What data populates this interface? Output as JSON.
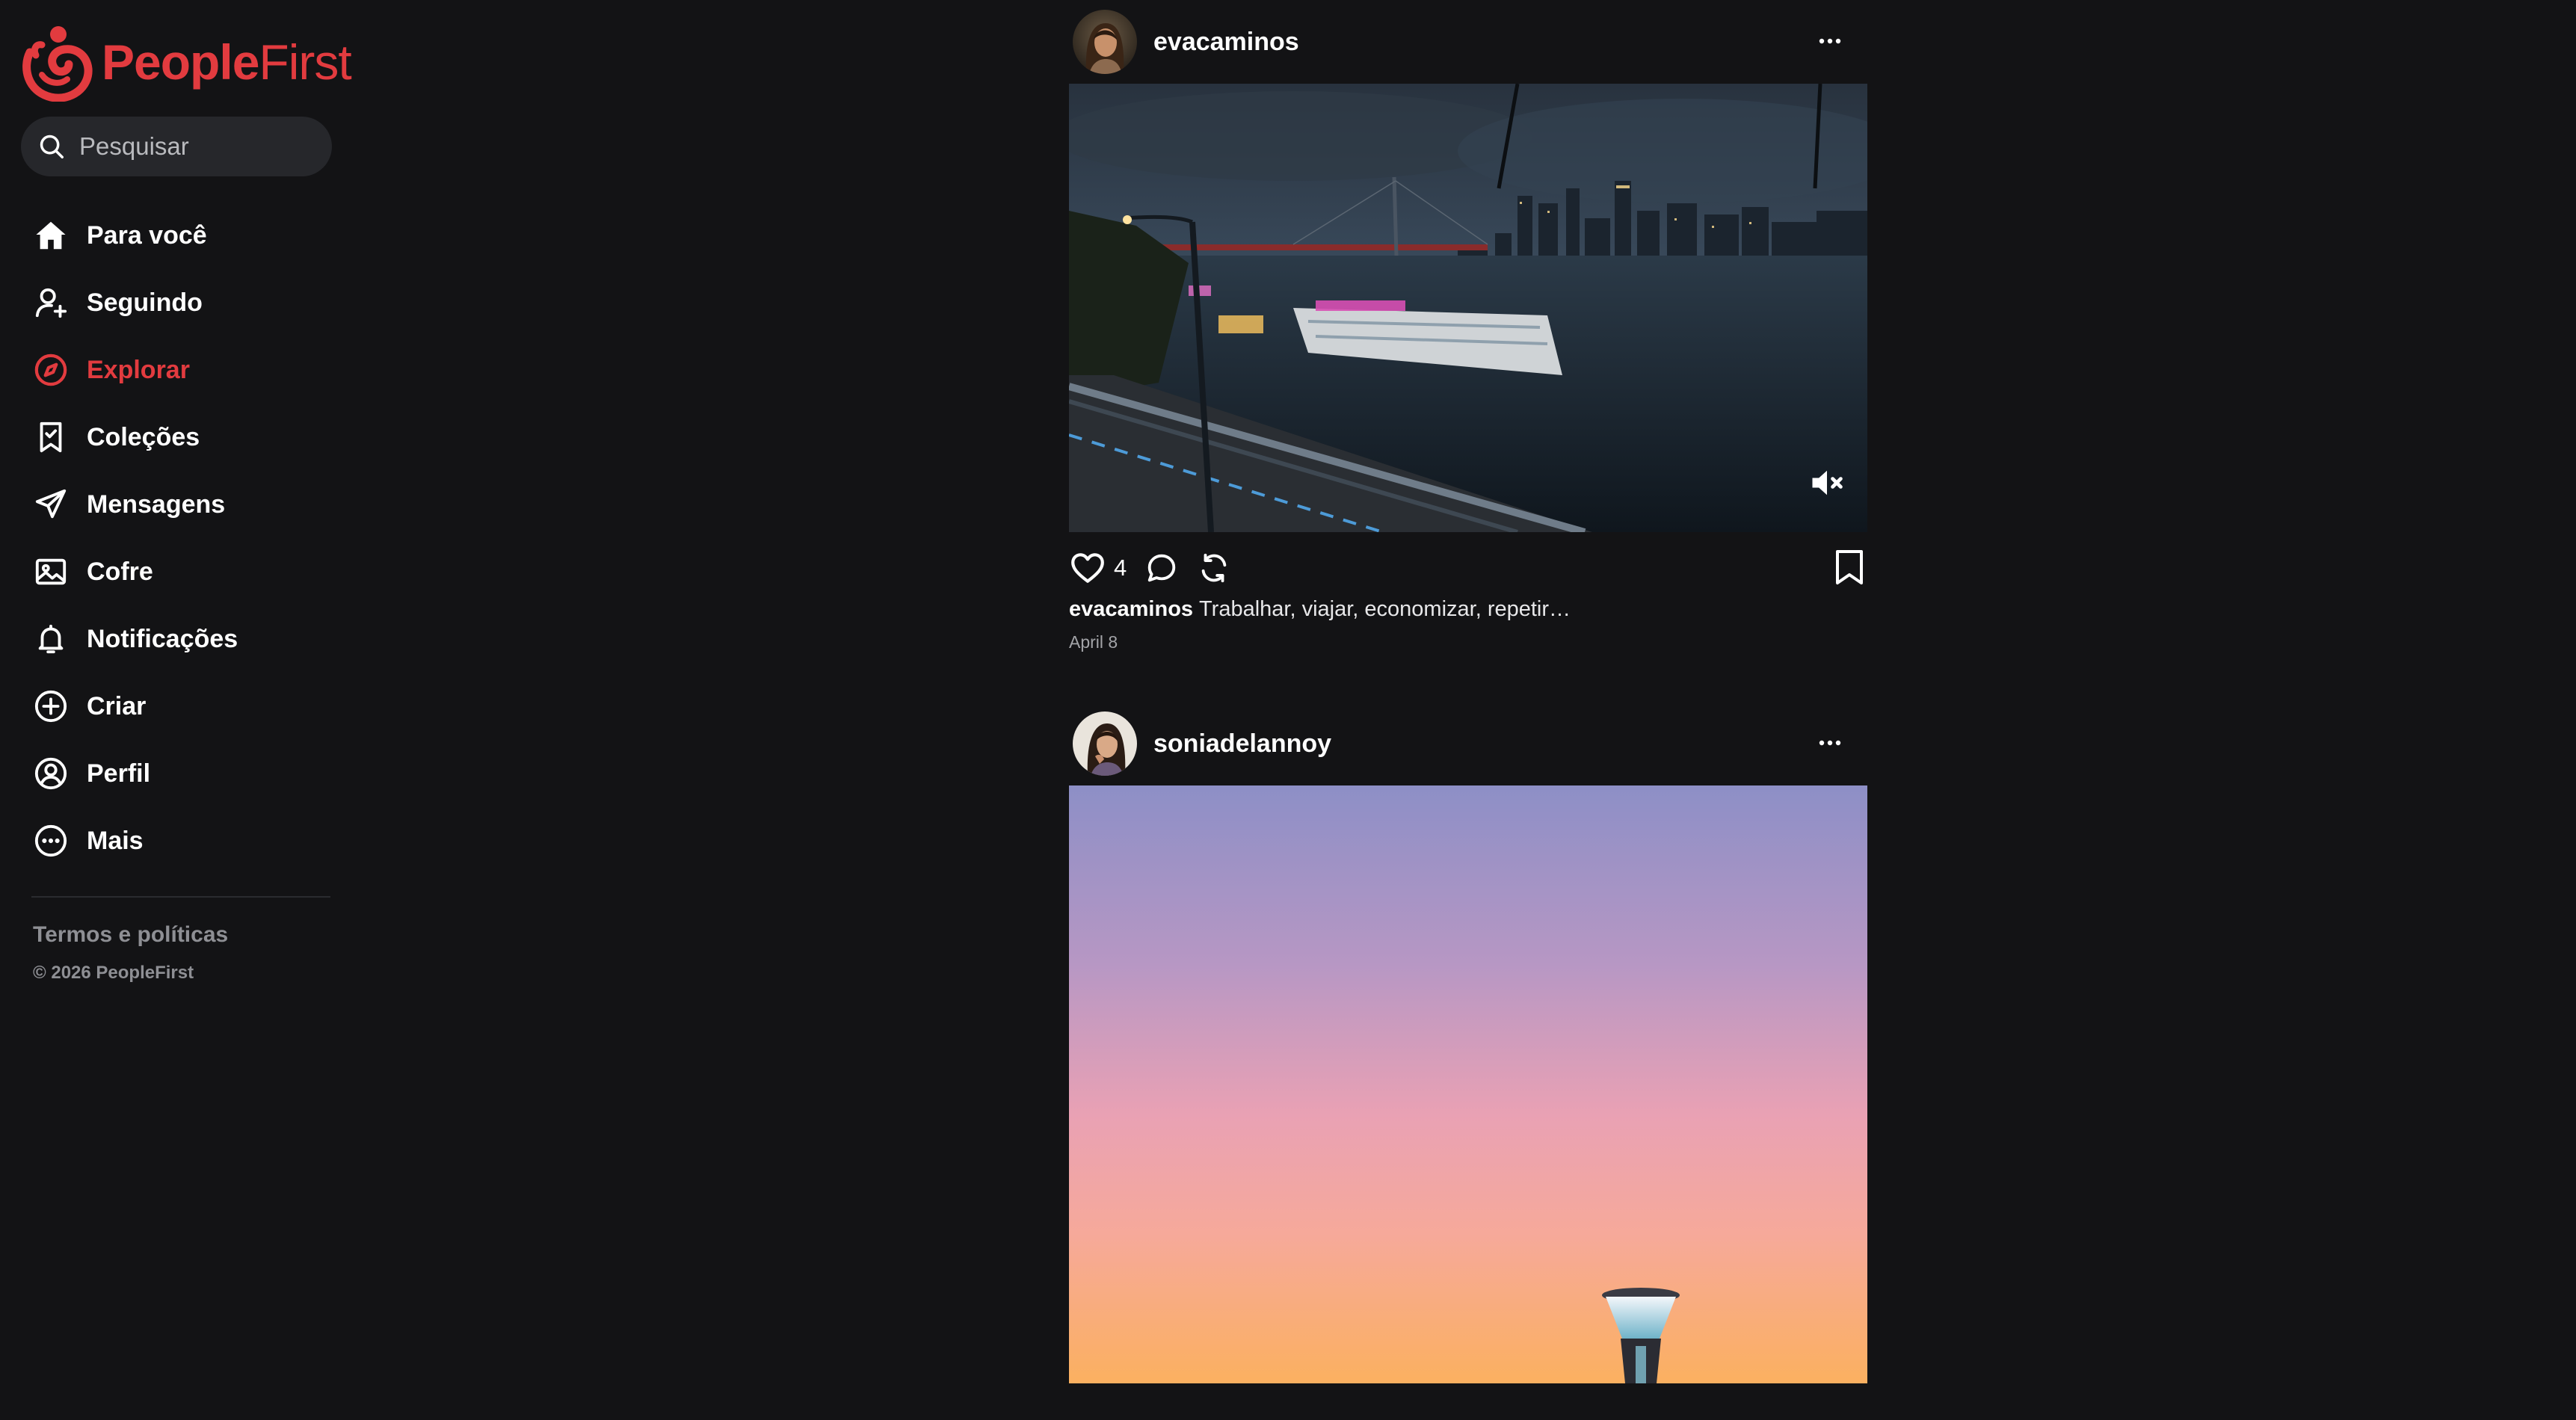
{
  "brand": {
    "name_bold": "People",
    "name_light": "First",
    "accent_color": "#e23b3f"
  },
  "search": {
    "placeholder": "Pesquisar",
    "icon": "search-icon"
  },
  "nav": {
    "items": [
      {
        "label": "Para você",
        "icon": "home-icon",
        "active": false
      },
      {
        "label": "Seguindo",
        "icon": "user-follow-icon",
        "active": false
      },
      {
        "label": "Explorar",
        "icon": "compass-icon",
        "active": true
      },
      {
        "label": "Coleções",
        "icon": "bookmark-check-icon",
        "active": false
      },
      {
        "label": "Mensagens",
        "icon": "send-icon",
        "active": false
      },
      {
        "label": "Cofre",
        "icon": "image-icon",
        "active": false
      },
      {
        "label": "Notificações",
        "icon": "bell-icon",
        "active": false
      },
      {
        "label": "Criar",
        "icon": "plus-circle-icon",
        "active": false
      },
      {
        "label": "Perfil",
        "icon": "user-circle-icon",
        "active": false
      },
      {
        "label": "Mais",
        "icon": "more-circle-icon",
        "active": false
      }
    ]
  },
  "footer": {
    "terms": "Termos e políticas",
    "copyright": "© 2026 PeopleFirst"
  },
  "posts": [
    {
      "username": "evacaminos",
      "media_type": "video",
      "muted": true,
      "likes": "4",
      "caption_user": "evacaminos",
      "caption": "Trabalhar, viajar, economizar, repetir…",
      "date": "April 8"
    },
    {
      "username": "soniadelannoy",
      "media_type": "image"
    }
  ]
}
